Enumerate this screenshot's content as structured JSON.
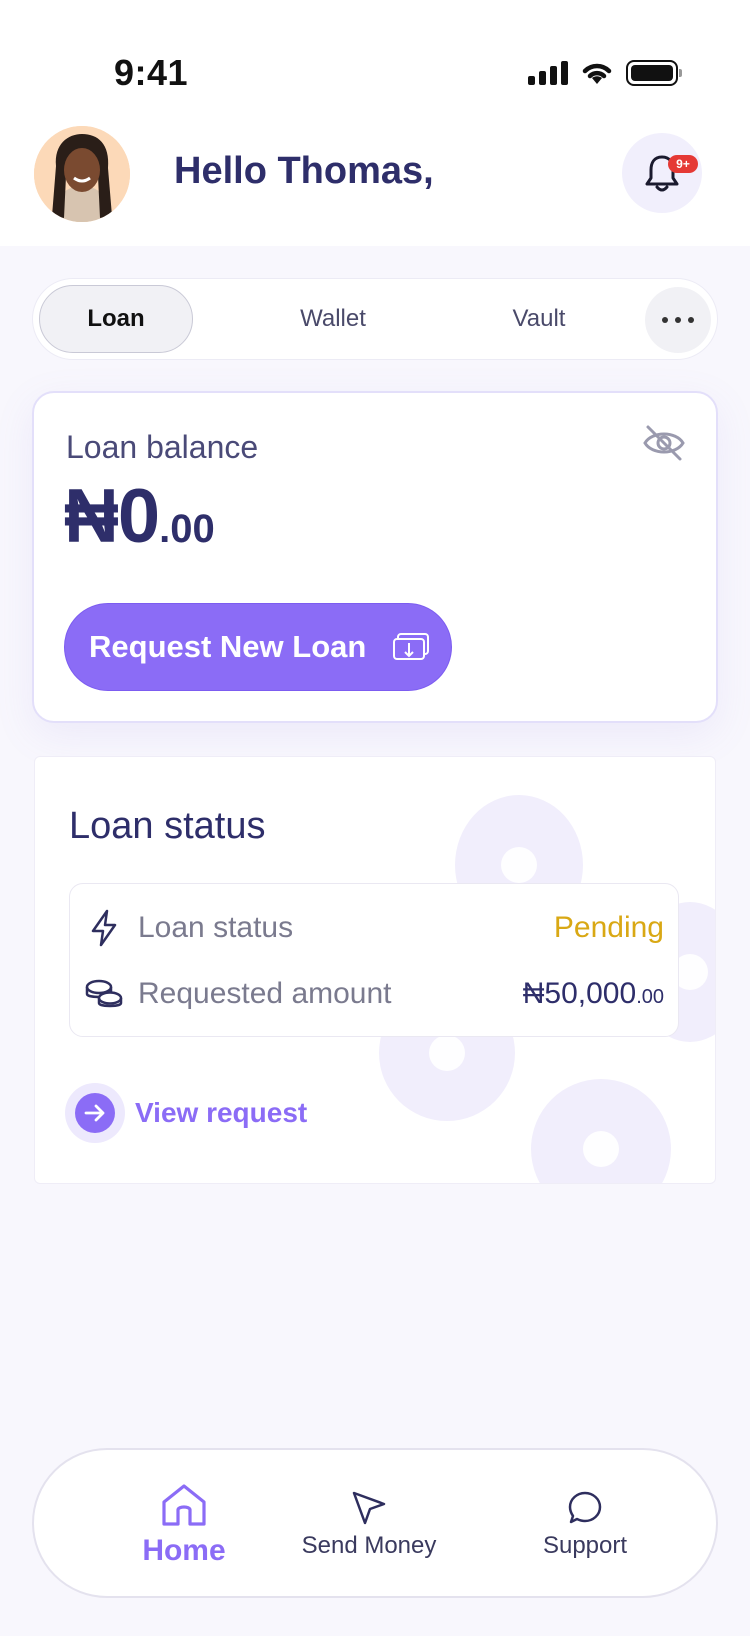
{
  "status_bar": {
    "time": "9:41",
    "icons": [
      "signal-icon",
      "wifi-icon",
      "battery-icon"
    ]
  },
  "header": {
    "greeting": "Hello Thomas,",
    "notification_badge": "9+",
    "avatar": "user-avatar",
    "bell_icon": "bell-icon"
  },
  "tabs": {
    "items": [
      {
        "label": "Loan",
        "active": true
      },
      {
        "label": "Wallet",
        "active": false
      },
      {
        "label": "Vault",
        "active": false
      }
    ],
    "more_icon": "more-horizontal-icon"
  },
  "balance_card": {
    "label": "Loan balance",
    "amount_main": "₦0",
    "amount_decimal": ".00",
    "hide_icon": "eye-off-icon",
    "request_button_label": "Request New Loan",
    "request_icon": "cash-icon"
  },
  "loan_status_card": {
    "title": "Loan status",
    "rows": [
      {
        "label": "Loan status",
        "value": "Pending",
        "icon": "lightning-icon"
      },
      {
        "label": "Requested amount",
        "value_main": "₦50,000",
        "value_decimal": ".00",
        "icon": "coins-icon"
      }
    ],
    "view_request_label": "View request"
  },
  "bottom_nav": {
    "items": [
      {
        "label": "Home",
        "icon": "home-icon",
        "active": true
      },
      {
        "label": "Send Money",
        "icon": "send-icon",
        "active": false
      },
      {
        "label": "Support",
        "icon": "chat-icon",
        "active": false
      }
    ]
  },
  "colors": {
    "accent": "#8B6CF6",
    "heading": "#2E2E6A",
    "pending": "#D9A814",
    "badge": "#E53935",
    "background": "#F8F7FD"
  }
}
